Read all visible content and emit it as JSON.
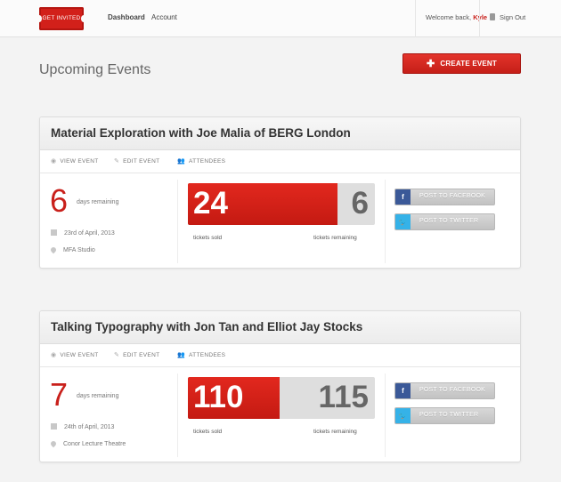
{
  "header": {
    "logo_text": "GET INVITED",
    "nav": [
      {
        "label": "Dashboard",
        "active": true
      },
      {
        "label": "Account",
        "active": false
      }
    ],
    "welcome_prefix": "Welcome back,",
    "user_name": "Kyle",
    "signout_label": "Sign Out"
  },
  "main": {
    "title": "Upcoming Events",
    "create_button": "CREATE EVENT"
  },
  "actions": {
    "view": "VIEW EVENT",
    "edit": "EDIT EVENT",
    "attendees": "ATTENDEES"
  },
  "labels": {
    "days_remaining": "days remaining",
    "tickets_sold": "tickets sold",
    "tickets_remaining": "tickets remaining",
    "post_facebook": "POST TO FACEBOOK",
    "post_twitter": "POST TO TWITTER"
  },
  "events": [
    {
      "title": "Material Exploration with Joe Malia of BERG London",
      "days": "6",
      "date": "23rd of April, 2013",
      "venue": "MFA Studio",
      "sold": 24,
      "remaining": 6
    },
    {
      "title": "Talking Typography with Jon Tan and Elliot Jay Stocks",
      "days": "7",
      "date": "24th of April, 2013",
      "venue": "Conor Lecture Theatre",
      "sold": 110,
      "remaining": 115
    }
  ],
  "colors": {
    "accent": "#c9201b",
    "facebook": "#3b5998",
    "twitter": "#35b2e8"
  }
}
